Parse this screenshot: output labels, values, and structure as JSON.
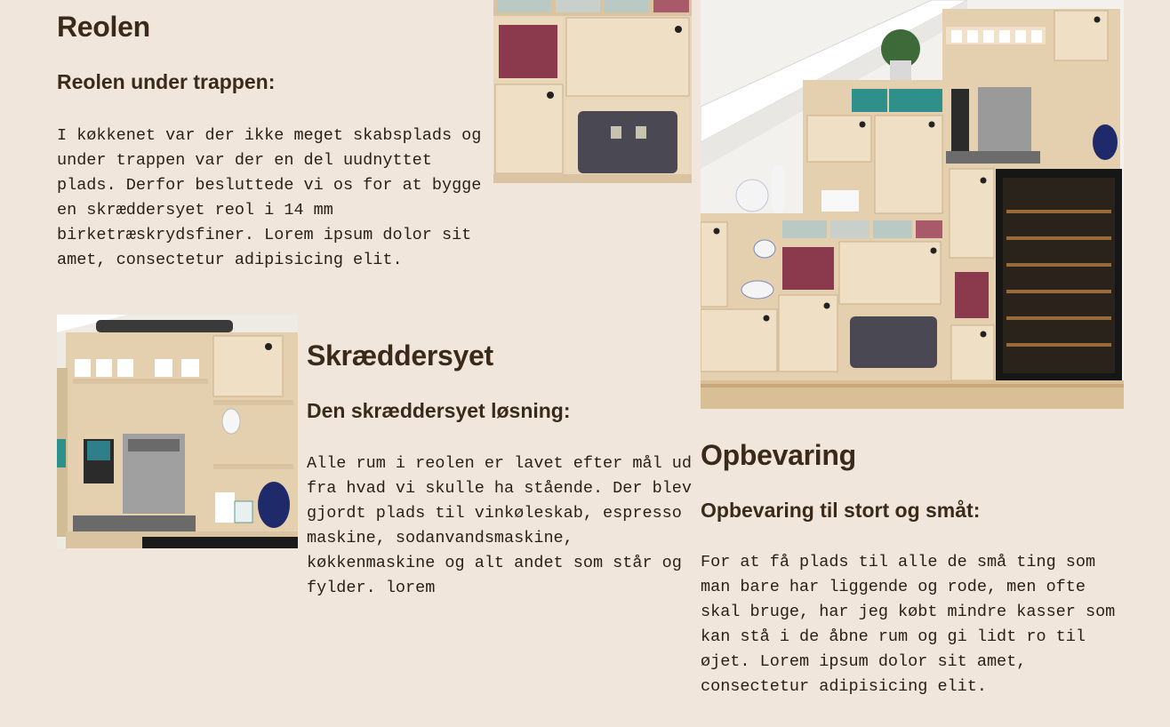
{
  "sections": [
    {
      "title": "Reolen",
      "subtitle": "Reolen under trappen:",
      "body": "I køkkenet var der ikke meget skabsplads og under trappen var der en del uudnyttet plads. Derfor besluttede vi os for at bygge en skræddersyet reol i 14 mm birketræskrydsfiner. Lorem ipsum dolor sit amet, consectetur adipisicing elit."
    },
    {
      "title": "Skræddersyet",
      "subtitle": "Den skræddersyet løsning:",
      "body": "Alle rum i reolen er lavet efter mål ud fra hvad vi skulle ha stående. Der blev gjordt plads til vinkøleskab, espresso maskine, sodanvandsmaskine, køkkenmaskine og alt andet som står og fylder. lorem"
    },
    {
      "title": "Opbevaring",
      "subtitle": "Opbevaring til stort og småt:",
      "body": "For at få plads til alle de små ting som man bare har liggende og rode, men ofte skal bruge, har jeg købt mindre kasser som kan stå i de åbne rum og gi lidt ro til øjet. Lorem ipsum dolor sit amet, consectetur adipisicing elit."
    }
  ],
  "colors": {
    "background": "#f0e6dc",
    "heading": "#3a2a1a",
    "text": "#2a2018",
    "plywood": "#e4cfae",
    "dark_case": "#4a4852",
    "basket_red": "#8a3a4c",
    "basket_teal": "#2f8f8a",
    "jug_blue": "#1f2a6a"
  }
}
